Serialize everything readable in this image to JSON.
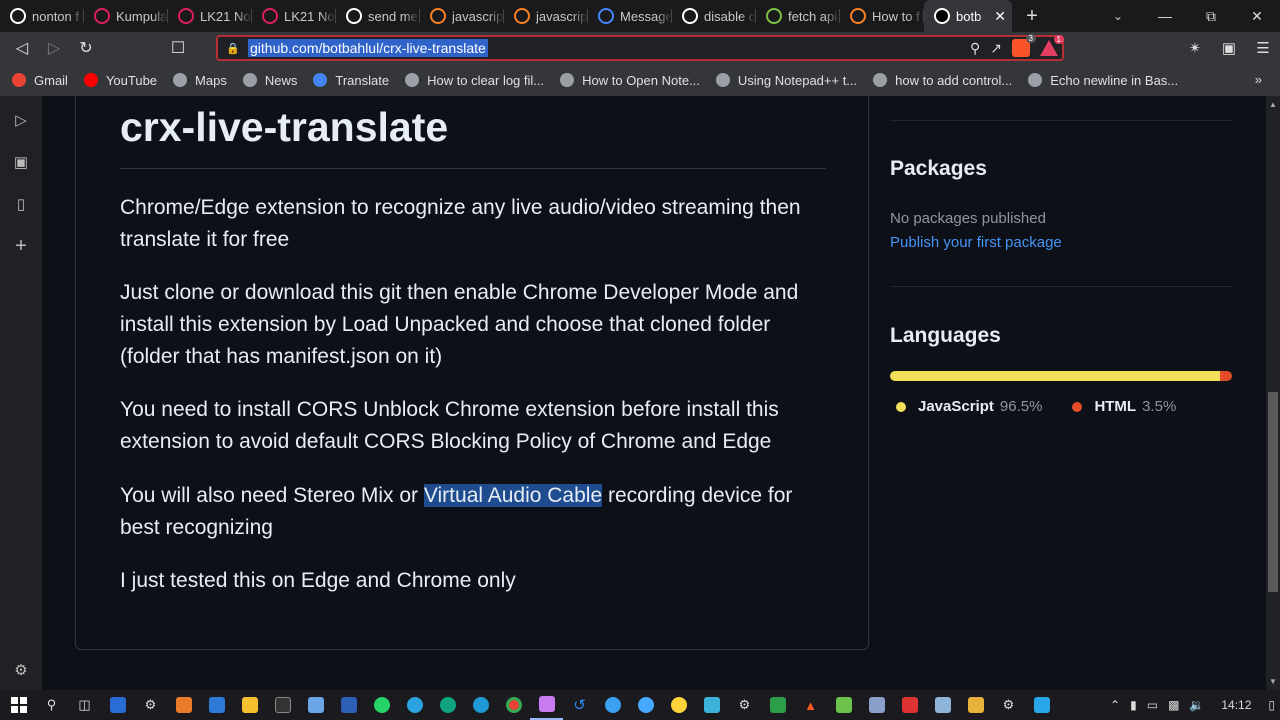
{
  "tabs": [
    {
      "title": "nonton f",
      "icon": "google-icon",
      "color": "#ffffff"
    },
    {
      "title": "Kumpula",
      "icon": "slack-icon",
      "color": "#e01e5a"
    },
    {
      "title": "LK21 No",
      "icon": "slack-icon",
      "color": "#e01e5a"
    },
    {
      "title": "LK21 No",
      "icon": "slack-icon",
      "color": "#e01e5a"
    },
    {
      "title": "send me",
      "icon": "google-icon",
      "color": "#ffffff"
    },
    {
      "title": "javascrip",
      "icon": "stackoverflow-icon",
      "color": "#f48024"
    },
    {
      "title": "javascrip",
      "icon": "stackoverflow-icon",
      "color": "#f48024"
    },
    {
      "title": "Message",
      "icon": "chrome-icon",
      "color": "#4285f4"
    },
    {
      "title": "disable c",
      "icon": "google-icon",
      "color": "#ffffff"
    },
    {
      "title": "fetch api",
      "icon": "sparkle-icon",
      "color": "#7cc242"
    },
    {
      "title": "How to f",
      "icon": "stackoverflow-icon",
      "color": "#f48024"
    },
    {
      "title": "botb",
      "icon": "github-icon",
      "color": "#ffffff",
      "active": true
    }
  ],
  "toolbar": {
    "url": "github.com/botbahlul/crx-live-translate",
    "brave_badge": "3",
    "rewards_badge": "1"
  },
  "bookmarks": [
    {
      "label": "Gmail",
      "color": "#ea4335"
    },
    {
      "label": "YouTube",
      "color": "#ff0000"
    },
    {
      "label": "Maps",
      "color": "#9aa0a6"
    },
    {
      "label": "News",
      "color": "#9aa0a6"
    },
    {
      "label": "Translate",
      "color": "#4285f4"
    },
    {
      "label": "How to clear log fil...",
      "color": "#9aa0a6"
    },
    {
      "label": "How to Open Note...",
      "color": "#9aa0a6"
    },
    {
      "label": "Using Notepad++ t...",
      "color": "#9aa0a6"
    },
    {
      "label": "how to add control...",
      "color": "#9aa0a6"
    },
    {
      "label": "Echo newline in Bas...",
      "color": "#9aa0a6"
    }
  ],
  "readme": {
    "title": "crx-live-translate",
    "p1": "Chrome/Edge extension to recognize any live audio/video streaming then translate it for free",
    "p2": "Just clone or download this git then enable Chrome Developer Mode and install this extension by Load Unpacked and choose that cloned folder (folder that has manifest.json on it)",
    "p3": "You need to install CORS Unblock Chrome extension before install this extension to avoid default CORS Blocking Policy of Chrome and Edge",
    "p4_before": "You will also need Stereo Mix or ",
    "p4_selected": "Virtual Audio Cable",
    "p4_after": " recording device for best recognizing",
    "p5": "I just tested this on Edge and Chrome only"
  },
  "sidebar": {
    "packages_heading": "Packages",
    "packages_none": "No packages published",
    "packages_link": "Publish your first package",
    "languages_heading": "Languages",
    "languages": [
      {
        "name": "JavaScript",
        "percent": "96.5%",
        "value": 96.5,
        "color": "#f1e05a"
      },
      {
        "name": "HTML",
        "percent": "3.5%",
        "value": 3.5,
        "color": "#e34c26"
      }
    ]
  },
  "taskbar": {
    "time": "14:12"
  }
}
